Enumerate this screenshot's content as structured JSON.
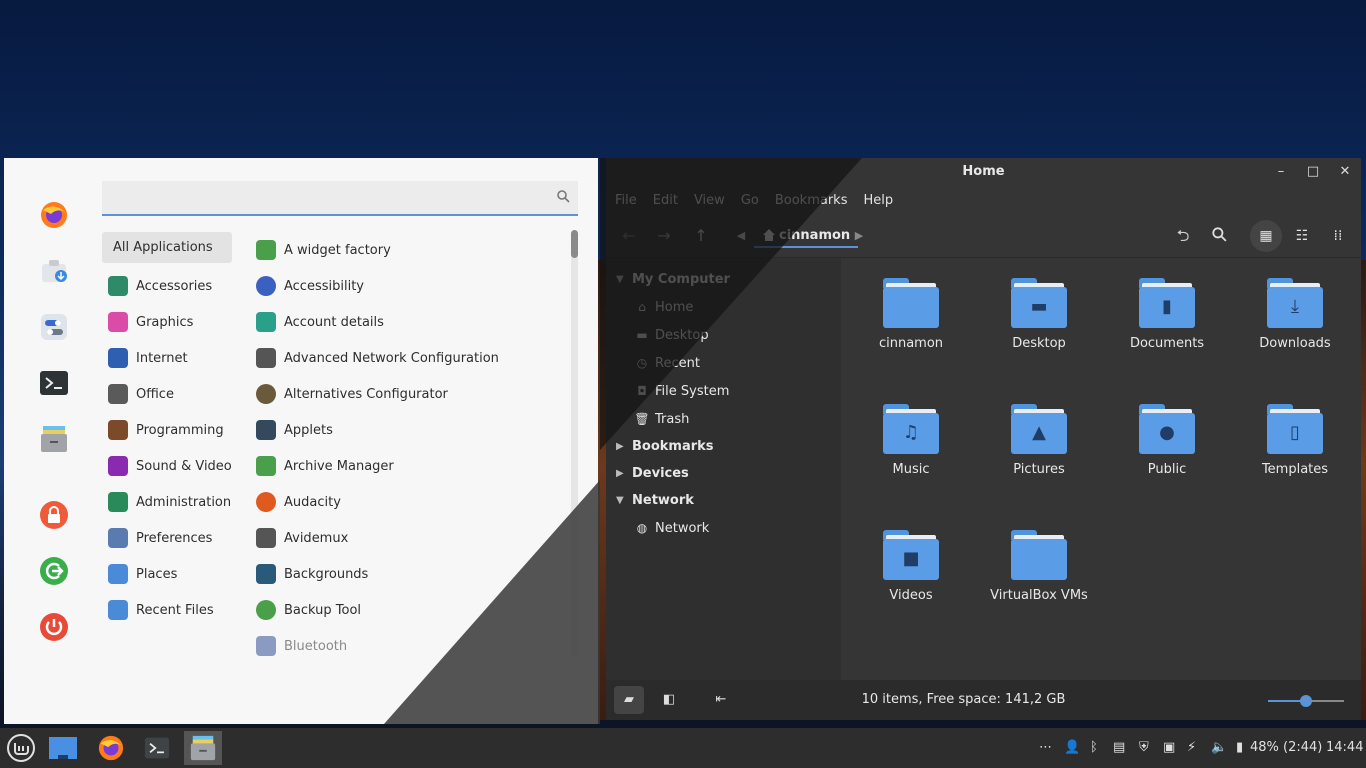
{
  "menu": {
    "search": {
      "placeholder": ""
    },
    "favorites": [
      "firefox-icon",
      "software-manager-icon",
      "settings-icon",
      "terminal-icon",
      "files-icon"
    ],
    "session": [
      "lock-icon",
      "logout-icon",
      "power-icon"
    ],
    "categories": [
      {
        "label": "All Applications",
        "icon": "all-apps-icon",
        "color": "#e3e3e3"
      },
      {
        "label": "Accessories",
        "icon": "accessories-icon",
        "color": "#2f8a6a"
      },
      {
        "label": "Graphics",
        "icon": "graphics-icon",
        "color": "#d94da8"
      },
      {
        "label": "Internet",
        "icon": "internet-icon",
        "color": "#2f5fb0"
      },
      {
        "label": "Office",
        "icon": "office-icon",
        "color": "#5a5a5a"
      },
      {
        "label": "Programming",
        "icon": "programming-icon",
        "color": "#7a4a2a"
      },
      {
        "label": "Sound & Video",
        "icon": "sound-video-icon",
        "color": "#8a2ab0"
      },
      {
        "label": "Administration",
        "icon": "administration-icon",
        "color": "#2a8a5a"
      },
      {
        "label": "Preferences",
        "icon": "preferences-icon",
        "color": "#5a7ab0"
      },
      {
        "label": "Places",
        "icon": "places-icon",
        "color": "#4a8ad6"
      },
      {
        "label": "Recent Files",
        "icon": "recent-files-icon",
        "color": "#4a8ad6"
      }
    ],
    "apps": [
      {
        "label": "A widget factory",
        "icon": "widget-factory-icon",
        "color": "#4aa04a"
      },
      {
        "label": "Accessibility",
        "icon": "accessibility-icon",
        "color": "#3a60c0"
      },
      {
        "label": "Account details",
        "icon": "account-details-icon",
        "color": "#2aa08a"
      },
      {
        "label": "Advanced Network Configuration",
        "icon": "network-config-icon",
        "color": "#555555"
      },
      {
        "label": "Alternatives Configurator",
        "icon": "alternatives-icon",
        "color": "#6a5a3a"
      },
      {
        "label": "Applets",
        "icon": "applets-icon",
        "color": "#34495e"
      },
      {
        "label": "Archive Manager",
        "icon": "archive-manager-icon",
        "color": "#4aa04a"
      },
      {
        "label": "Audacity",
        "icon": "audacity-icon",
        "color": "#e05a20"
      },
      {
        "label": "Avidemux",
        "icon": "avidemux-icon",
        "color": "#555555"
      },
      {
        "label": "Backgrounds",
        "icon": "backgrounds-icon",
        "color": "#2a5a7a"
      },
      {
        "label": "Backup Tool",
        "icon": "backup-tool-icon",
        "color": "#4aa04a"
      },
      {
        "label": "Bluetooth",
        "icon": "bluetooth-icon",
        "color": "#8a9ac0"
      }
    ]
  },
  "nemo": {
    "title": "Home",
    "menus": [
      "File",
      "Edit",
      "View",
      "Go",
      "Bookmarks",
      "Help"
    ],
    "breadcrumb": "cinnamon",
    "sidebar": {
      "my_computer": "My Computer",
      "items": [
        {
          "label": "Home",
          "icon": "home-icon"
        },
        {
          "label": "Desktop",
          "icon": "desktop-icon"
        },
        {
          "label": "Recent",
          "icon": "recent-icon"
        },
        {
          "label": "File System",
          "icon": "drive-icon"
        },
        {
          "label": "Trash",
          "icon": "trash-icon"
        }
      ],
      "bookmarks": "Bookmarks",
      "devices": "Devices",
      "network_header": "Network",
      "network_item": "Network"
    },
    "folders": [
      {
        "label": "cinnamon",
        "glyph": ""
      },
      {
        "label": "Desktop",
        "glyph": "▬"
      },
      {
        "label": "Documents",
        "glyph": "▮"
      },
      {
        "label": "Downloads",
        "glyph": "⤓"
      },
      {
        "label": "Music",
        "glyph": "♫"
      },
      {
        "label": "Pictures",
        "glyph": "▲"
      },
      {
        "label": "Public",
        "glyph": "●"
      },
      {
        "label": "Templates",
        "glyph": "▯"
      },
      {
        "label": "Videos",
        "glyph": "■"
      },
      {
        "label": "VirtualBox VMs",
        "glyph": ""
      }
    ],
    "status": "10 items, Free space: 141,2 GB",
    "zoom_level": 0.5
  },
  "panel": {
    "battery": "48% (2:44)",
    "clock": "14:44"
  },
  "colors": {
    "accent": "#5b93d6",
    "folder": "#5a9ce6"
  }
}
